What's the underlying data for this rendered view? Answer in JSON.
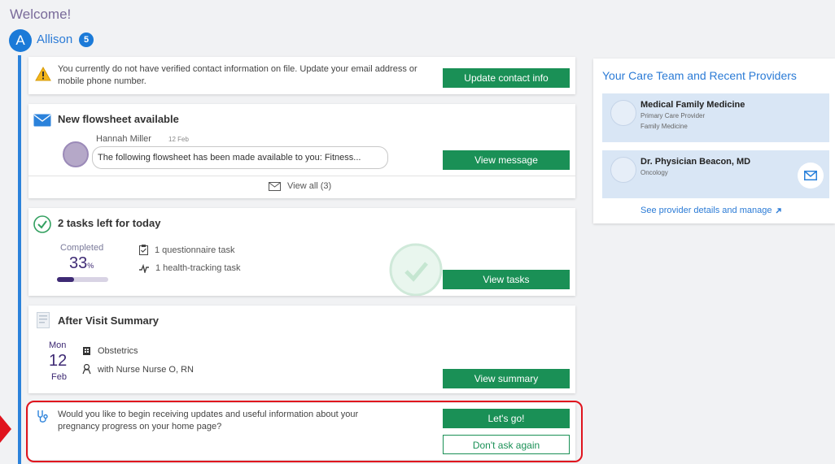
{
  "header": {
    "welcome": "Welcome!",
    "avatar_letter": "A",
    "user_name": "Allison",
    "notification_count": "5"
  },
  "contact_card": {
    "message": "You currently do not have verified contact information on file. Update your email address or mobile phone number.",
    "button": "Update contact info"
  },
  "flowsheet_card": {
    "title": "New flowsheet available",
    "sender": "Hannah Miller",
    "date": "12 Feb",
    "preview": "The following flowsheet has been made available to you: Fitness...",
    "button": "View message",
    "view_all": "View all (3)"
  },
  "tasks_card": {
    "title": "2 tasks left for today",
    "completed_label": "Completed",
    "percent": "33",
    "percent_sign": "%",
    "progress_fraction": 0.33,
    "task1": "1 questionnaire task",
    "task2": "1 health-tracking task",
    "button": "View tasks"
  },
  "avs_card": {
    "title": "After Visit Summary",
    "weekday": "Mon",
    "day": "12",
    "month": "Feb",
    "department": "Obstetrics",
    "provider": "with Nurse Nurse O, RN",
    "button": "View summary"
  },
  "pregnancy_card": {
    "message": "Would you like to begin receiving updates and useful information about your pregnancy progress on your home page?",
    "button_go": "Let's go!",
    "button_dismiss": "Don't ask again"
  },
  "care_team": {
    "title": "Your Care Team and Recent Providers",
    "providers": [
      {
        "name": "Medical Family Medicine",
        "line1": "Primary Care Provider",
        "line2": "Family Medicine"
      },
      {
        "name": "Dr. Physician Beacon, MD",
        "line1": "Oncology"
      }
    ],
    "link": "See provider details and manage"
  },
  "colors": {
    "accent_blue": "#2b7bd6",
    "button_green": "#1a9056",
    "highlight_red": "#e0141e",
    "purple": "#3e2a74"
  }
}
